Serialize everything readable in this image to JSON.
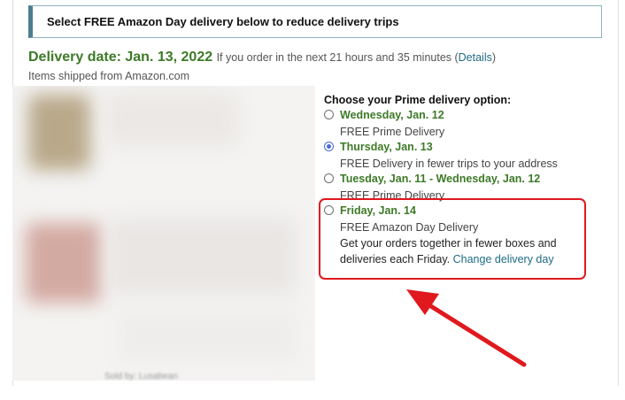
{
  "banner": {
    "text": "Select FREE Amazon Day delivery below to reduce delivery trips"
  },
  "delivery": {
    "date_label": "Delivery date: Jan. 13, 2022",
    "condition": "If you order in the next 21 hours and 35 minutes (",
    "details_link": "Details",
    "condition_close": ")",
    "shipped_from": "Items shipped from Amazon.com"
  },
  "options": {
    "title": "Choose your Prime delivery option:",
    "items": [
      {
        "date": "Wednesday, Jan. 12",
        "subtitle": "FREE Prime Delivery",
        "selected": false
      },
      {
        "date": "Thursday, Jan. 13",
        "subtitle": "FREE Delivery in fewer trips to your address",
        "selected": true
      },
      {
        "date": "Tuesday, Jan. 11 - Wednesday, Jan. 12",
        "subtitle": "FREE Prime Delivery",
        "selected": false
      },
      {
        "date": "Friday, Jan. 14",
        "subtitle": "FREE Amazon Day Delivery",
        "selected": false,
        "desc_line1": "Get your orders together in fewer boxes and",
        "desc_line2": "deliveries each Friday.",
        "desc_link": "Change delivery day"
      }
    ]
  },
  "blurred_footer": "Sold by: Lusabean",
  "colors": {
    "delivery_green": "#3d7a28",
    "link_blue": "#1d6b86",
    "highlight_red": "#e0191e",
    "radio_selected": "#4a6bd6"
  }
}
